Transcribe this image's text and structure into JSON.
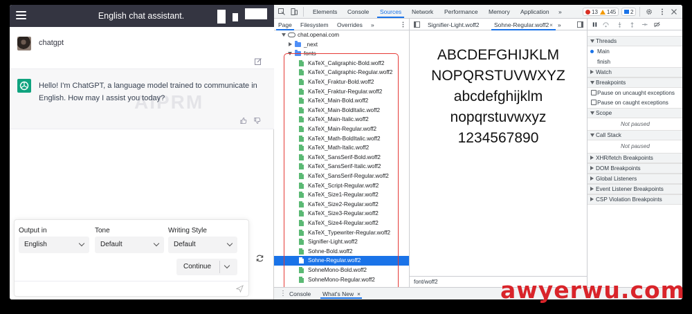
{
  "chat": {
    "title": "English chat assistant.",
    "user_name": "chatgpt",
    "bot_message": "Hello! I'm ChatGPT, a language model trained to communicate in English. How may I assist you today?",
    "watermark": "AIPRM",
    "output_label": "Output in",
    "output_value": "English",
    "tone_label": "Tone",
    "tone_value": "Default",
    "style_label": "Writing Style",
    "style_value": "Default",
    "continue_label": "Continue",
    "accent": "#10a37f",
    "header_bg": "#343541"
  },
  "devtools": {
    "tabs": [
      "Elements",
      "Console",
      "Sources",
      "Network",
      "Performance",
      "Memory",
      "Application"
    ],
    "more": "»",
    "error_count": "13",
    "warning_count": "145",
    "info_count": "2",
    "nav_tabs": [
      "Page",
      "Filesystem",
      "Overrides"
    ],
    "origin": "chat.openai.com",
    "next_folder": "_next",
    "fonts_folder": "fonts",
    "files": [
      "KaTeX_Caligraphic-Bold.woff2",
      "KaTeX_Caligraphic-Regular.woff2",
      "KaTeX_Fraktur-Bold.woff2",
      "KaTeX_Fraktur-Regular.woff2",
      "KaTeX_Main-Bold.woff2",
      "KaTeX_Main-BoldItalic.woff2",
      "KaTeX_Main-Italic.woff2",
      "KaTeX_Main-Regular.woff2",
      "KaTeX_Math-BoldItalic.woff2",
      "KaTeX_Math-Italic.woff2",
      "KaTeX_SansSerif-Bold.woff2",
      "KaTeX_SansSerif-Italic.woff2",
      "KaTeX_SansSerif-Regular.woff2",
      "KaTeX_Script-Regular.woff2",
      "KaTeX_Size1-Regular.woff2",
      "KaTeX_Size2-Regular.woff2",
      "KaTeX_Size3-Regular.woff2",
      "KaTeX_Size4-Regular.woff2",
      "KaTeX_Typewriter-Regular.woff2",
      "Signifier-Light.woff2",
      "Sohne-Bold.woff2",
      "Sohne-Regular.woff2",
      "SohneMono-Bold.woff2",
      "SohneMono-Regular.woff2"
    ],
    "selected_file": "Sohne-Regular.woff2",
    "editor_tabs": [
      "Signifier-Light.woff2",
      "Sohne-Regular.woff2"
    ],
    "preview_lines": [
      "ABCDEFGHIJKLM",
      "NOPQRSTUVWXYZ",
      "abcdefghijklm",
      "nopqrstuvwxyz",
      "1234567890"
    ],
    "editor_status": "font/woff2",
    "threads_label": "Threads",
    "thread_main": "Main",
    "thread_finish": "finish",
    "watch_label": "Watch",
    "breakpoints_label": "Breakpoints",
    "pause_uncaught": "Pause on uncaught exceptions",
    "pause_caught": "Pause on caught exceptions",
    "scope_label": "Scope",
    "not_paused": "Not paused",
    "callstack_label": "Call Stack",
    "xhr_label": "XHR/fetch Breakpoints",
    "dom_label": "DOM Breakpoints",
    "global_label": "Global Listeners",
    "event_label": "Event Listener Breakpoints",
    "csp_label": "CSP Violation Breakpoints",
    "drawer_console": "Console",
    "drawer_whatsnew": "What's New",
    "close_glyph": "×",
    "accent": "#1a73e8"
  },
  "site_watermark": "awyerwu.com"
}
